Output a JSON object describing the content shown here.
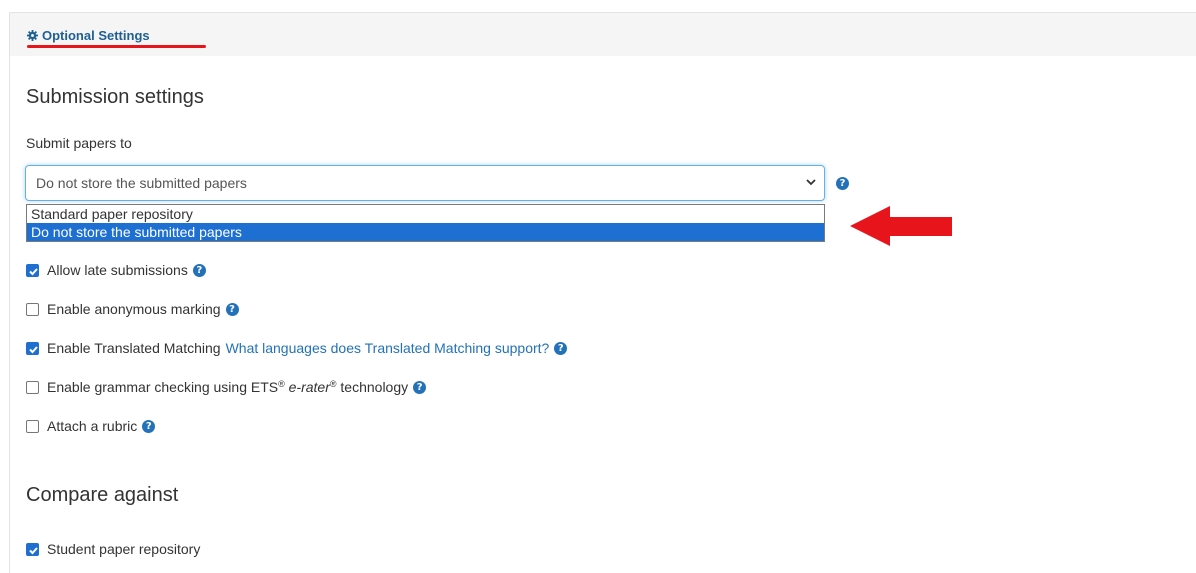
{
  "header": {
    "title": "Optional Settings",
    "icon": "gear-icon"
  },
  "submission": {
    "heading": "Submission settings",
    "submit_label": "Submit papers to",
    "selected": "Do not store the submitted papers",
    "options": [
      "Standard paper repository",
      "Do not store the submitted papers"
    ],
    "help_glyph": "?"
  },
  "checks": {
    "late": {
      "label": "Allow late submissions",
      "checked": true
    },
    "anonymous": {
      "label": "Enable anonymous marking",
      "checked": false
    },
    "translated": {
      "label": "Enable Translated Matching",
      "link": "What languages does Translated Matching support?",
      "checked": true
    },
    "grammar": {
      "prefix": "Enable grammar checking using ETS",
      "reg1": "®",
      "erater": "e-rater",
      "reg2": "®",
      "suffix": "technology",
      "checked": false
    },
    "rubric": {
      "label": "Attach a rubric",
      "checked": false
    }
  },
  "compare": {
    "heading": "Compare against",
    "student_repo": {
      "label": "Student paper repository",
      "checked": true
    }
  },
  "colors": {
    "accent": "#1f5f93",
    "annotation_red": "#e8141c",
    "select_highlight": "#1d6fd1"
  }
}
